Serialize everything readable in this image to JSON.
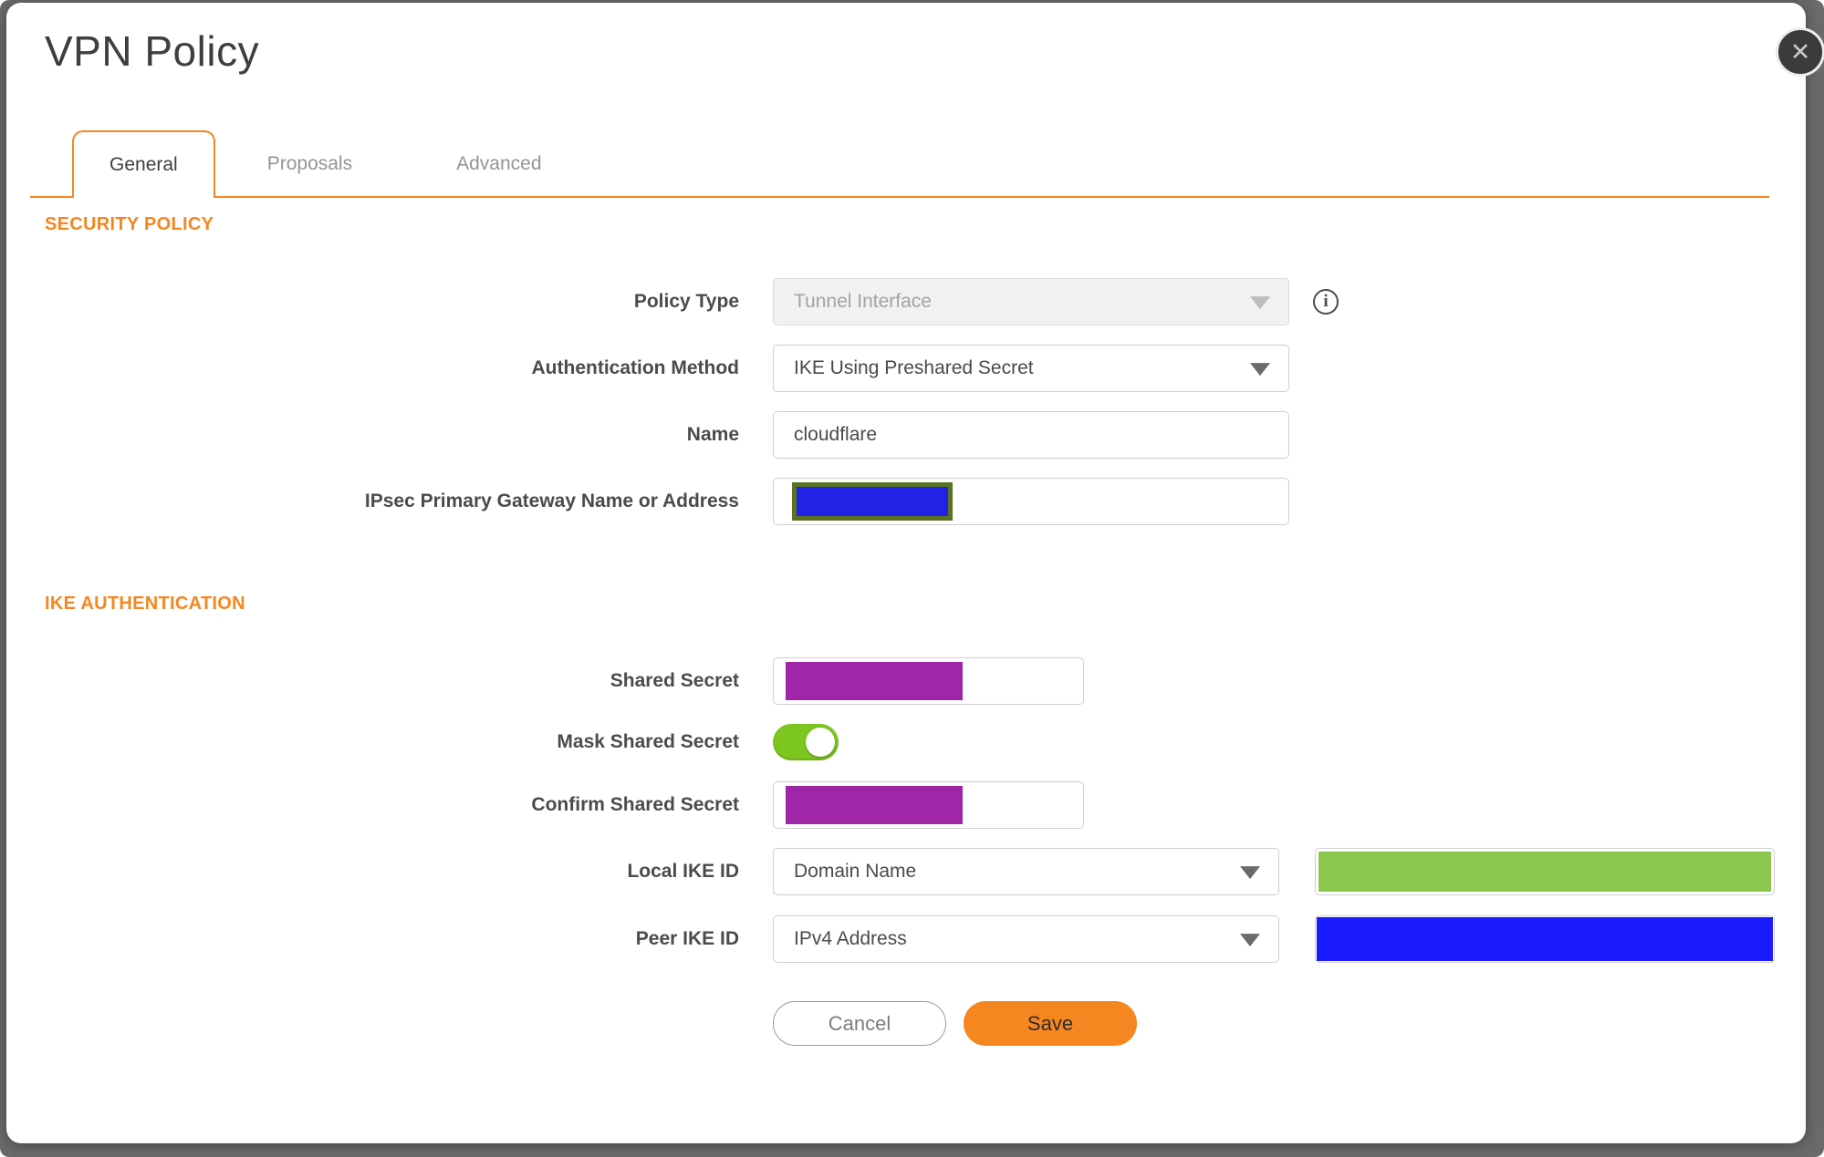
{
  "dialog": {
    "title": "VPN Policy"
  },
  "close": {
    "icon": "✕"
  },
  "tabs": [
    {
      "label": "General",
      "active": true
    },
    {
      "label": "Proposals",
      "active": false
    },
    {
      "label": "Advanced",
      "active": false
    }
  ],
  "security_policy": {
    "heading": "SECURITY POLICY",
    "policy_type": {
      "label": "Policy Type",
      "value": "Tunnel Interface",
      "disabled": true
    },
    "auth_method": {
      "label": "Authentication Method",
      "value": "IKE Using Preshared Secret"
    },
    "name": {
      "label": "Name",
      "value": "cloudflare"
    },
    "gateway": {
      "label": "IPsec Primary Gateway Name or Address",
      "value": "",
      "redacted": true
    }
  },
  "ike_authentication": {
    "heading": "IKE AUTHENTICATION",
    "shared_secret": {
      "label": "Shared Secret",
      "redacted": true
    },
    "mask_shared_secret": {
      "label": "Mask Shared Secret",
      "enabled": true
    },
    "confirm_shared_secret": {
      "label": "Confirm Shared Secret",
      "redacted": true
    },
    "local_ike_id": {
      "label": "Local IKE ID",
      "type_value": "Domain Name",
      "value_redacted": true
    },
    "peer_ike_id": {
      "label": "Peer IKE ID",
      "type_value": "IPv4 Address",
      "value_redacted": true
    }
  },
  "actions": {
    "cancel": "Cancel",
    "save": "Save"
  },
  "colors": {
    "accent_orange": "#f6861f",
    "toggle_green": "#7dc51f",
    "redaction_purple": "#9f27a7",
    "redaction_blue": "#1a1aff",
    "redaction_gateway_blue": "#2222e4",
    "redaction_olive_border": "#5a7323",
    "redaction_light_green": "#8cc84d"
  }
}
